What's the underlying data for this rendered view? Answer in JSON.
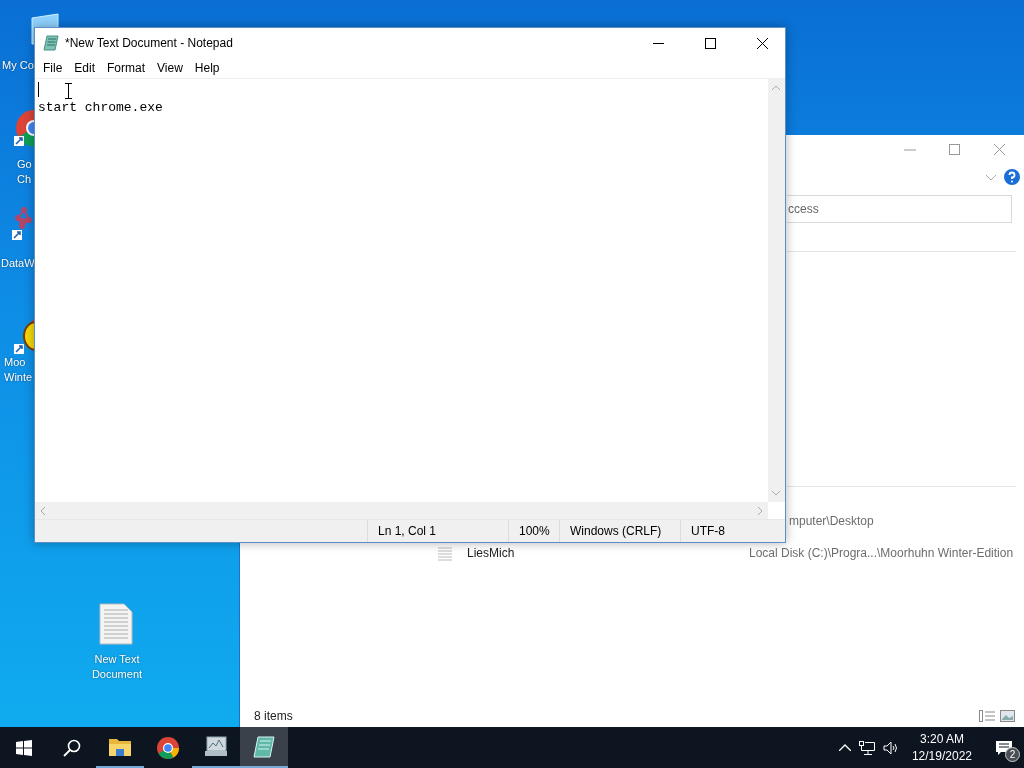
{
  "desktop_icons": [
    {
      "kind": "computer",
      "lines": [
        "My Co"
      ]
    },
    {
      "kind": "chrome",
      "lines": [
        "Go",
        "Ch"
      ]
    },
    {
      "kind": "molecule",
      "lines": [
        "DataW"
      ]
    },
    {
      "kind": "chicken",
      "lines": [
        "Moo",
        "Winte"
      ]
    },
    {
      "kind": "document",
      "lines": [
        "New Text",
        "Document"
      ]
    }
  ],
  "explorer": {
    "search_placeholder": "ccess",
    "path_text": "mputer\\Desktop",
    "row": {
      "name": "LiesMich",
      "location": "Local Disk (C:)\\Progra...\\Moorhuhn Winter-Edition"
    },
    "status": "8 items"
  },
  "notepad": {
    "title": "*New Text Document - Notepad",
    "menu": [
      "File",
      "Edit",
      "Format",
      "View",
      "Help"
    ],
    "lines": [
      "start chrome.exe"
    ],
    "status": [
      "Ln 1, Col 1",
      "100%",
      "Windows (CRLF)",
      "UTF-8"
    ]
  },
  "taskbar": {
    "apps": [
      {
        "kind": "start",
        "running": false,
        "selected": false
      },
      {
        "kind": "search",
        "running": false,
        "selected": false
      },
      {
        "kind": "folder",
        "running": true,
        "selected": false
      },
      {
        "kind": "chrome",
        "running": false,
        "selected": false
      },
      {
        "kind": "monitor",
        "running": true,
        "selected": false
      },
      {
        "kind": "notepad",
        "running": true,
        "selected": true
      }
    ],
    "time": "3:20 AM",
    "date": "12/19/2022",
    "notifications": "2"
  }
}
